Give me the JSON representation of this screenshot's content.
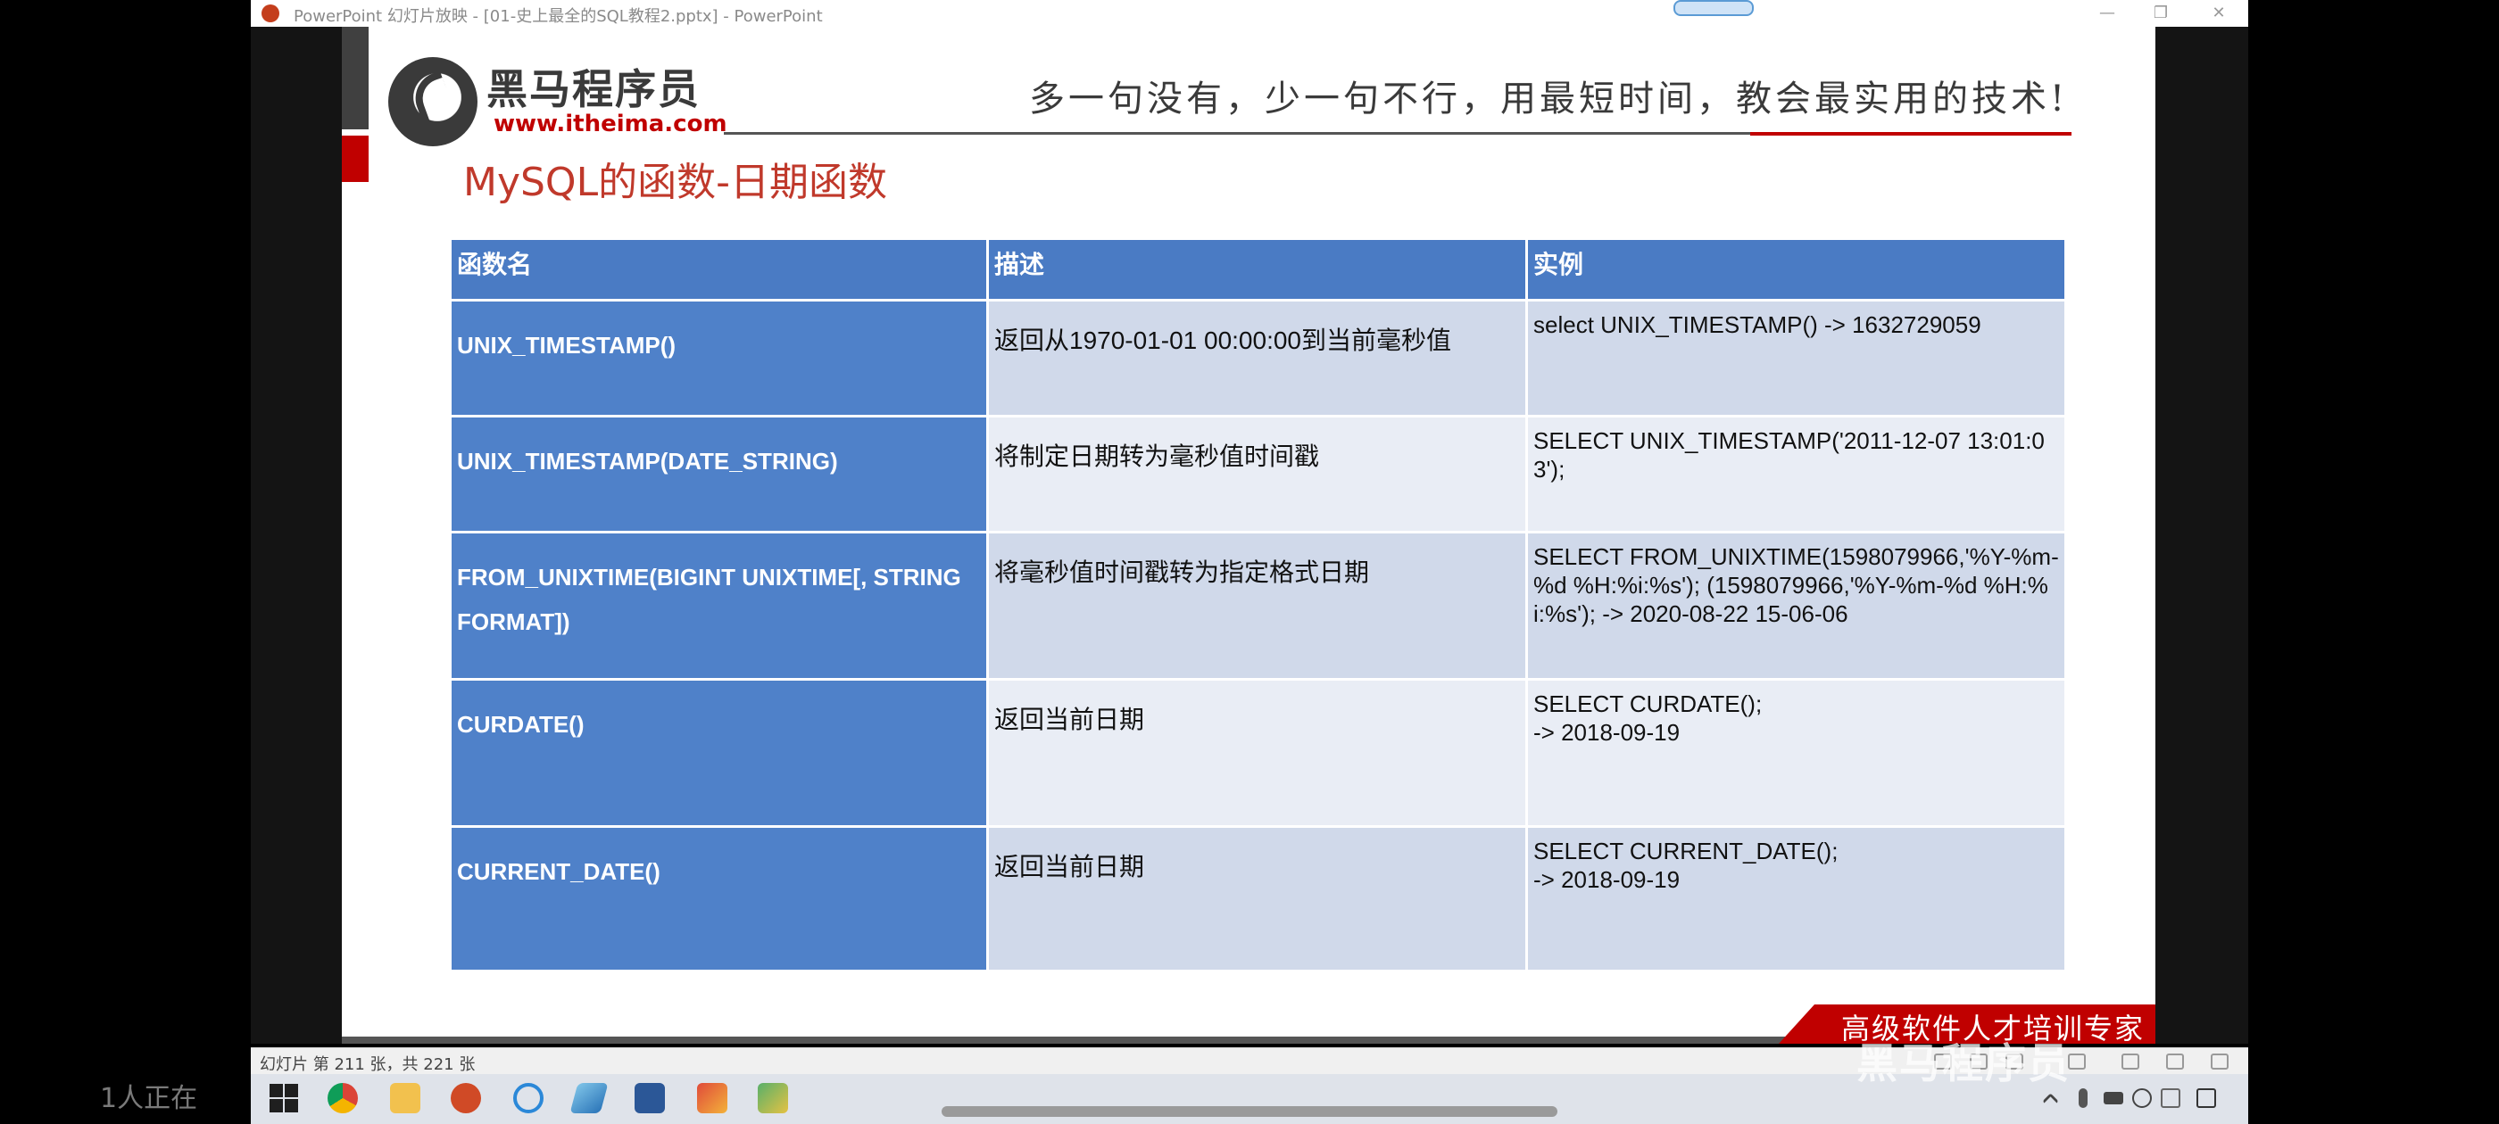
{
  "window": {
    "title": "PowerPoint 幻灯片放映 - [01-史上最全的SQL教程2.pptx] - PowerPoint",
    "minimize_glyph": "—",
    "maximize_glyph": "❐",
    "close_glyph": "✕"
  },
  "slide": {
    "logo_text": "黑马程序员",
    "logo_url": "www.itheima.com",
    "slogan": "多一句没有，少一句不行，用最短时间，教会最实用的技术!",
    "title": "MySQL的函数-日期函数",
    "banner": "高级软件人才培训专家",
    "table": {
      "headers": [
        "函数名",
        "描述",
        "实例"
      ],
      "rows": [
        {
          "name": "UNIX_TIMESTAMP()",
          "desc": "返回从1970-01-01 00:00:00到当前毫秒值",
          "example": "select UNIX_TIMESTAMP() -> 1632729059"
        },
        {
          "name": "UNIX_TIMESTAMP(DATE_STRING)",
          "desc": "将制定日期转为毫秒值时间戳",
          "example": "SELECT UNIX_TIMESTAMP('2011-12-07 13:01:03');"
        },
        {
          "name": "FROM_UNIXTIME(BIGINT UNIXTIME[, STRING FORMAT])",
          "desc": "将毫秒值时间戳转为指定格式日期",
          "example": "SELECT FROM_UNIXTIME(1598079966,'%Y-%m-%d %H:%i:%s'); (1598079966,'%Y-%m-%d %H:%i:%s'); -> 2020-08-22 15-06-06"
        },
        {
          "name": "CURDATE()",
          "desc": "返回当前日期",
          "example": "SELECT CURDATE();\n-> 2018-09-19"
        },
        {
          "name": "CURRENT_DATE()",
          "desc": "返回当前日期",
          "example": "SELECT CURRENT_DATE();\n-> 2018-09-19"
        }
      ]
    }
  },
  "statusbar": {
    "slide_info": "幻灯片 第 211 张，共 221 张"
  },
  "taskbar": {
    "apps": [
      "start-icon",
      "chrome-icon",
      "file-explorer-icon",
      "powerpoint-icon",
      "browser-icon",
      "app-icon",
      "word-icon",
      "paint-icon",
      "image-editor-icon"
    ]
  },
  "overlay": {
    "viewers": "1人正在",
    "watermark": "黑马程序员"
  },
  "colors": {
    "header_blue": "#4a7bc4",
    "name_cell_blue": "#4f81c9",
    "accent_red": "#c00000",
    "row_light": "#e9edf5",
    "row_mid": "#d0d9ea"
  }
}
